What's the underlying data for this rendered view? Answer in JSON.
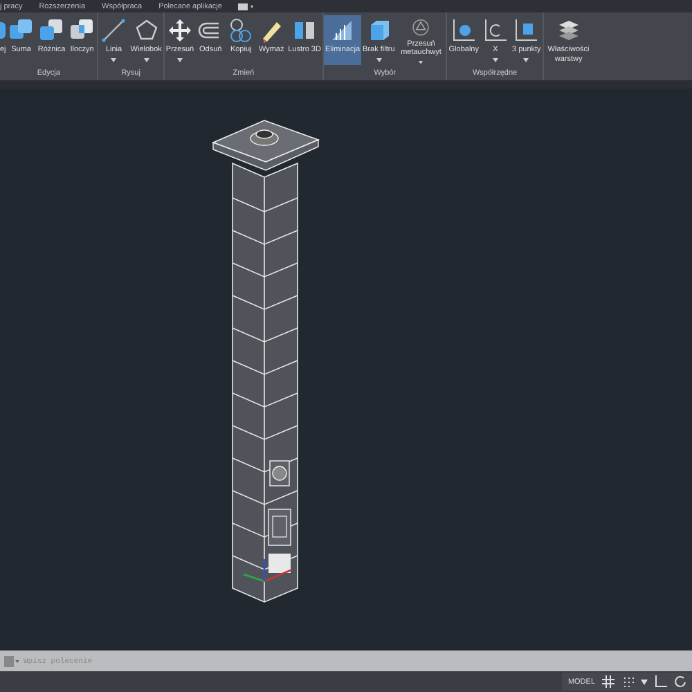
{
  "tabs": [
    {
      "label": "j pracy"
    },
    {
      "label": "Rozszerzenia"
    },
    {
      "label": "Współpraca"
    },
    {
      "label": "Polecane aplikacje"
    }
  ],
  "panels": [
    {
      "title": "Edycja",
      "buttons": [
        {
          "label": "ej",
          "selected": false,
          "dropdown": false
        },
        {
          "label": "Suma",
          "selected": false,
          "dropdown": false
        },
        {
          "label": "Różnica",
          "selected": false,
          "dropdown": false
        },
        {
          "label": "Iloczyn",
          "selected": false,
          "dropdown": false
        }
      ]
    },
    {
      "title": "Rysuj",
      "buttons": [
        {
          "label": "Linia",
          "selected": false,
          "dropdown": true
        },
        {
          "label": "Wielobok",
          "selected": false,
          "dropdown": true
        }
      ]
    },
    {
      "title": "Zmień",
      "buttons": [
        {
          "label": "Przesuń",
          "selected": false,
          "dropdown": true
        },
        {
          "label": "Odsuń",
          "selected": false,
          "dropdown": false
        },
        {
          "label": "Kopiuj",
          "selected": false,
          "dropdown": false
        },
        {
          "label": "Wymaż",
          "selected": false,
          "dropdown": false
        },
        {
          "label": "Lustro 3D",
          "selected": false,
          "dropdown": false
        }
      ]
    },
    {
      "title": "Wybór",
      "buttons": [
        {
          "label": "Eliminacja",
          "selected": true,
          "dropdown": false
        },
        {
          "label": "Brak filtru",
          "selected": false,
          "dropdown": true
        },
        {
          "label": "Przesuń metauchwyt",
          "selected": false,
          "dropdown": true
        }
      ]
    },
    {
      "title": "Współrzędne",
      "buttons": [
        {
          "label": "Globalny",
          "selected": false,
          "dropdown": false
        },
        {
          "label": "X",
          "selected": false,
          "dropdown": true
        },
        {
          "label": "3 punkty",
          "selected": false,
          "dropdown": true
        }
      ]
    },
    {
      "buttons": [
        {
          "label": "Właściwości warstwy",
          "selected": false,
          "dropdown": false
        }
      ]
    }
  ],
  "command_line": {
    "placeholder": "Wpisz polecenie"
  },
  "status_bar": {
    "model": "MODEL"
  }
}
